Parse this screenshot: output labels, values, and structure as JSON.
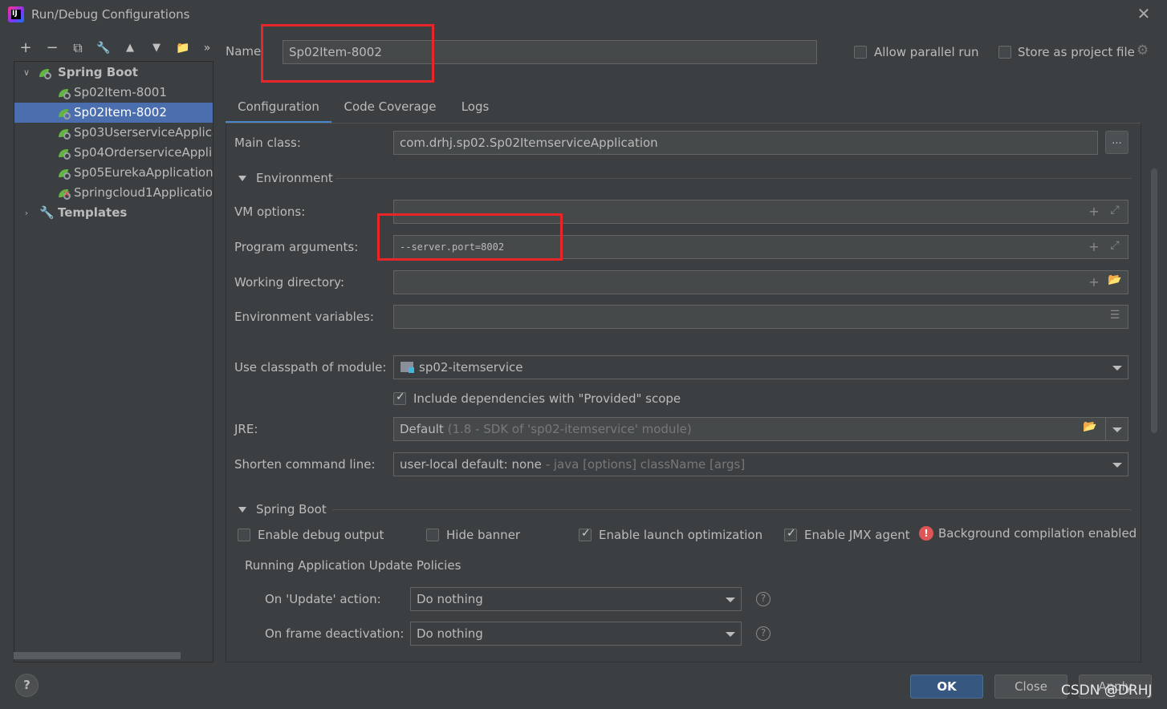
{
  "window": {
    "title": "Run/Debug Configurations",
    "app_icon_text": "IJ"
  },
  "toolbar": {
    "add": "+",
    "remove": "−",
    "copy": "⧉",
    "edit": "🔧",
    "up": "▲",
    "down": "▼",
    "folder": "📁",
    "more": "»"
  },
  "tree": {
    "group_label": "Spring Boot",
    "items": [
      {
        "label": "Sp02Item-8001",
        "selected": false,
        "error": false
      },
      {
        "label": "Sp02Item-8002",
        "selected": true,
        "error": false
      },
      {
        "label": "Sp03UserserviceApplica",
        "selected": false,
        "error": false
      },
      {
        "label": "Sp04OrderserviceApplic",
        "selected": false,
        "error": false
      },
      {
        "label": "Sp05EurekaApplication",
        "selected": false,
        "error": false
      },
      {
        "label": "Springcloud1Applicatio",
        "selected": false,
        "error": true
      }
    ],
    "templates_label": "Templates"
  },
  "header": {
    "name_label": "Name",
    "name_value": "Sp02Item-8002",
    "allow_parallel_label": "Allow parallel run",
    "allow_parallel_checked": false,
    "store_project_label": "Store as project file",
    "store_project_checked": false
  },
  "tabs": [
    {
      "label": "Configuration",
      "active": true
    },
    {
      "label": "Code Coverage",
      "active": false
    },
    {
      "label": "Logs",
      "active": false
    }
  ],
  "config": {
    "main_class_label": "Main class:",
    "main_class_value": "com.drhj.sp02.Sp02ItemserviceApplication",
    "main_class_browse": "...",
    "environment_section": "Environment",
    "vm_options_label": "VM options:",
    "vm_options_value": "",
    "program_args_label": "Program arguments:",
    "program_args_value": "--server.port=8002",
    "working_dir_label": "Working directory:",
    "working_dir_value": "",
    "env_vars_label": "Environment variables:",
    "env_vars_value": "",
    "classpath_label": "Use classpath of module:",
    "classpath_value": "sp02-itemservice",
    "include_deps_label": "Include dependencies with \"Provided\" scope",
    "include_deps_checked": true,
    "jre_label": "JRE:",
    "jre_value": "Default",
    "jre_hint": "(1.8 - SDK of 'sp02-itemservice' module)",
    "shorten_label": "Shorten command line:",
    "shorten_value": "user-local default: none",
    "shorten_hint": "- java [options] className [args]"
  },
  "spring_boot": {
    "section": "Spring Boot",
    "enable_debug_label": "Enable debug output",
    "enable_debug_checked": false,
    "hide_banner_label": "Hide banner",
    "hide_banner_checked": false,
    "launch_opt_label": "Enable launch optimization",
    "launch_opt_checked": true,
    "jmx_label": "Enable JMX agent",
    "jmx_checked": true,
    "bg_compile_label": "Background compilation enabled",
    "policies_title": "Running Application Update Policies",
    "on_update_label": "On 'Update' action:",
    "on_update_value": "Do nothing",
    "on_frame_label": "On frame deactivation:",
    "on_frame_value": "Do nothing"
  },
  "footer": {
    "help": "?",
    "ok": "OK",
    "close": "Close",
    "apply": "Apply",
    "watermark": "CSDN @DRHJ"
  },
  "colors": {
    "background": "#3c3f41",
    "selection": "#4b6eaf",
    "primary_button": "#365880",
    "highlight_box": "#e8262a"
  }
}
